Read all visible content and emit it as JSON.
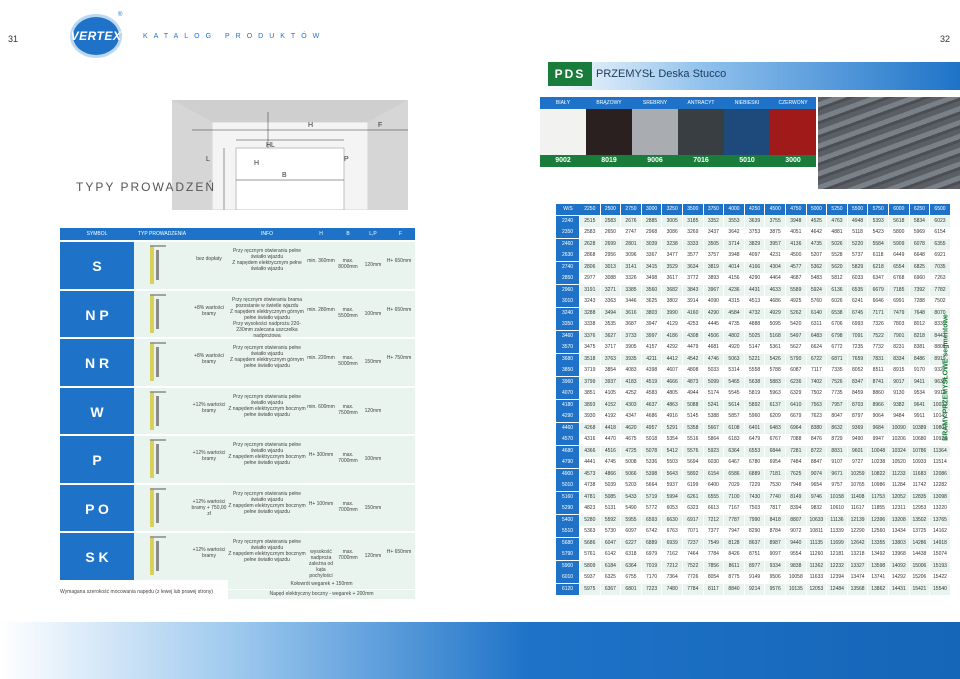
{
  "header": {
    "page_left": "31",
    "page_right": "32",
    "logo_text": "VERTEX",
    "catalog_label": "KATALOG PRODUKTÓW"
  },
  "product": {
    "badge": "PDS",
    "name": "PRZEMYSŁ Deska Stucco"
  },
  "colors": [
    {
      "name": "BIAŁY",
      "code": "9002",
      "hex": "#f2f2f0"
    },
    {
      "name": "BRĄZOWY",
      "code": "8019",
      "hex": "#2a2020"
    },
    {
      "name": "SREBRNY",
      "code": "9006",
      "hex": "#a9adb2"
    },
    {
      "name": "ANTRACYT",
      "code": "7016",
      "hex": "#383e42"
    },
    {
      "name": "NIEBIESKI",
      "code": "5010",
      "hex": "#1d4a7a"
    },
    {
      "name": "CZERWONY",
      "code": "3000",
      "hex": "#a11a1a"
    }
  ],
  "diagram": {
    "labels": {
      "H_top": "H",
      "F": "F",
      "HL": "HL",
      "L": "L",
      "H": "H",
      "P": "P",
      "B": "B"
    }
  },
  "types_title": "TYPY PROWADZEŃ",
  "left_table": {
    "headers": {
      "symbol": "SYMBOL",
      "type": "TYP PROWADZENIA",
      "info": "INFO",
      "h": "H",
      "b": "B",
      "lp": "L,P",
      "f": "F"
    },
    "rows": [
      {
        "symbol": "S",
        "value": "bez dopłaty",
        "info": "Przy ręcznym otwieraniu pełne światło wjazdu\nZ napędem elektrycznym pełne światło wjazdu",
        "h": "min. 360mm",
        "b": "max. 8000mm",
        "lp": "120mm",
        "f": "H+ 650mm"
      },
      {
        "symbol": "N P",
        "value": "+8% wartości bramy",
        "info": "Przy ręcznym otwieraniu brama pozostanie w świetle wjazdu\nZ napędem elektrycznym górnym pełne światło wjazdu\nPrzy wysokości nadprożu 220-230mm zalecana uszczelka nadprożowa",
        "h": "min. 280mm",
        "b": "max. 5500mm",
        "lp": "100mm",
        "f": "H+ 650mm"
      },
      {
        "symbol": "N R",
        "value": "+8% wartości bramy",
        "info": "Przy ręcznym otwieraniu pełne światło wjazdu\nZ napędem elektrycznym górnym pełne światło wjazdu",
        "h": "min. 220mm",
        "b": "max. 5000mm",
        "lp": "150mm",
        "f": "H+ 750mm"
      },
      {
        "symbol": "W",
        "value": "+12% wartości bramy",
        "info": "Przy ręcznym otwieraniu pełne światło wjazdu\nZ napędem elektrycznym bocznym pełne światło wjazdu",
        "h": "min. 600mm",
        "b": "max. 7500mm",
        "lp": "120mm",
        "f": ""
      },
      {
        "symbol": "P",
        "value": "+12% wartości bramy",
        "info": "Przy ręcznym otwieraniu pełne światło wjazdu\nZ napędem elektrycznym bocznym pełne światło wjazdu",
        "h": "H+ 300mm",
        "b": "max. 7000mm",
        "lp": "100mm",
        "f": ""
      },
      {
        "symbol": "P O",
        "value": "+12% wartości bramy + 750,00 zł",
        "info": "Przy ręcznym otwieraniu pełne światło wjazdu\nZ napędem elektrycznym bocznym pełne światło wjazdu",
        "h": "H+ 100mm",
        "b": "max. 7000mm",
        "lp": "150mm",
        "f": ""
      },
      {
        "symbol": "S K",
        "value": "+12% wartości bramy",
        "info": "Przy ręcznym otwieraniu pełne światło wjazdu\nZ napędem elektrycznym bocznym pełne światło wjazdu",
        "h": "wysokość nadproża zależna od kąta pochylości",
        "b": "max. 7000mm",
        "lp": "120mm",
        "f": "H+ 650mm"
      }
    ],
    "footer_1": "Kołowrót wegarek + 150mm",
    "footer_2": "Napęd elektryczny boczny - wegarek + 200mm",
    "note": "Wymagana szerokość mocowania napędu (z lewej lub prawej strony)"
  },
  "price_table": {
    "corner": "W/S",
    "widths": [
      "2250",
      "2500",
      "2750",
      "3000",
      "3250",
      "3500",
      "3750",
      "4000",
      "4250",
      "4500",
      "4750",
      "5000",
      "5250",
      "5500",
      "5750",
      "6000",
      "6250",
      "6500"
    ],
    "heights": [
      "2240",
      "2350",
      "2460",
      "2630",
      "2740",
      "2850",
      "2960",
      "3010",
      "3240",
      "3350",
      "3460",
      "3570",
      "3680",
      "3850",
      "3960",
      "4070",
      "4180",
      "4290",
      "4460",
      "4570",
      "4680",
      "4790",
      "4900",
      "5010",
      "5160",
      "5290",
      "5400",
      "5510",
      "5680",
      "5790",
      "5900",
      "6010",
      "6120"
    ],
    "values": [
      [
        "2515",
        "2583",
        "2676",
        "2885",
        "3005",
        "3185",
        "3352",
        "3553",
        "3639",
        "3755",
        "3948",
        "4525",
        "4763",
        "4948",
        "5393",
        "5618",
        "5834",
        "6023"
      ],
      [
        "2583",
        "2650",
        "2747",
        "2968",
        "3086",
        "3269",
        "3437",
        "3642",
        "3753",
        "3875",
        "4051",
        "4642",
        "4881",
        "5118",
        "5423",
        "5800",
        "5969",
        "6154"
      ],
      [
        "2628",
        "2699",
        "2801",
        "3039",
        "3238",
        "3333",
        "3505",
        "3714",
        "3829",
        "3957",
        "4136",
        "4735",
        "5026",
        "5220",
        "5584",
        "5909",
        "6078",
        "6355"
      ],
      [
        "2868",
        "2956",
        "3096",
        "3367",
        "3477",
        "3577",
        "3757",
        "3948",
        "4097",
        "4231",
        "4500",
        "5207",
        "5528",
        "5737",
        "6118",
        "6449",
        "6648",
        "6921"
      ],
      [
        "2806",
        "3013",
        "3141",
        "3415",
        "3529",
        "3634",
        "3819",
        "4014",
        "4166",
        "4304",
        "4577",
        "5362",
        "5620",
        "5829",
        "6218",
        "6554",
        "6825",
        "7035"
      ],
      [
        "2977",
        "3088",
        "3326",
        "3498",
        "3617",
        "3772",
        "3893",
        "4156",
        "4290",
        "4464",
        "4687",
        "5483",
        "5812",
        "6033",
        "6347",
        "6768",
        "6960",
        "7263"
      ],
      [
        "3191",
        "3271",
        "3385",
        "3560",
        "3682",
        "3843",
        "3967",
        "4236",
        "4431",
        "4633",
        "5589",
        "5924",
        "6136",
        "6535",
        "6679",
        "7185",
        "7392",
        "7782"
      ],
      [
        "3243",
        "3363",
        "3446",
        "3625",
        "3802",
        "3914",
        "4090",
        "4315",
        "4513",
        "4686",
        "4925",
        "5760",
        "6026",
        "6241",
        "6646",
        "6991",
        "7288",
        "7502"
      ],
      [
        "3288",
        "3494",
        "3616",
        "3803",
        "3990",
        "4160",
        "4290",
        "4584",
        "4732",
        "4929",
        "5262",
        "6140",
        "6538",
        "6745",
        "7171",
        "7479",
        "7648",
        "8070"
      ],
      [
        "3338",
        "3535",
        "3687",
        "3947",
        "4129",
        "4253",
        "4445",
        "4735",
        "4888",
        "5095",
        "5420",
        "6311",
        "6706",
        "6993",
        "7326",
        "7803",
        "8012",
        "8335"
      ],
      [
        "3376",
        "3627",
        "3733",
        "3997",
        "4186",
        "4308",
        "4506",
        "4802",
        "5025",
        "5168",
        "5497",
        "6483",
        "6798",
        "7091",
        "7522",
        "7901",
        "8218",
        "8441"
      ],
      [
        "3475",
        "3717",
        "3905",
        "4157",
        "4292",
        "4479",
        "4681",
        "4920",
        "5147",
        "5361",
        "5627",
        "6624",
        "6772",
        "7235",
        "7732",
        "8231",
        "8381",
        "8809"
      ],
      [
        "3518",
        "3763",
        "3935",
        "4211",
        "4412",
        "4542",
        "4746",
        "5063",
        "5221",
        "5426",
        "5790",
        "6722",
        "6871",
        "7659",
        "7831",
        "8334",
        "8486",
        "8919"
      ],
      [
        "3719",
        "3854",
        "4083",
        "4398",
        "4607",
        "4808",
        "5033",
        "5314",
        "5558",
        "5788",
        "6087",
        "7117",
        "7335",
        "8052",
        "8511",
        "8915",
        "9170",
        "9327"
      ],
      [
        "3799",
        "3937",
        "4183",
        "4519",
        "4666",
        "4873",
        "5099",
        "5465",
        "5638",
        "5883",
        "6236",
        "7402",
        "7526",
        "8347",
        "8741",
        "9017",
        "9411",
        "9638"
      ],
      [
        "3851",
        "4105",
        "4252",
        "4583",
        "4805",
        "4944",
        "5174",
        "5545",
        "5819",
        "5963",
        "6329",
        "7502",
        "7735",
        "8459",
        "8860",
        "9130",
        "9534",
        "9914"
      ],
      [
        "3893",
        "4152",
        "4303",
        "4637",
        "4863",
        "5088",
        "5241",
        "5614",
        "5892",
        "6137",
        "6410",
        "7563",
        "7957",
        "8703",
        "8966",
        "9382",
        "9641",
        "10032"
      ],
      [
        "3930",
        "4192",
        "4347",
        "4686",
        "4916",
        "5145",
        "5388",
        "5857",
        "5960",
        "6209",
        "6679",
        "7623",
        "8047",
        "8797",
        "9064",
        "9484",
        "9911",
        "10149"
      ],
      [
        "4268",
        "4418",
        "4620",
        "4957",
        "5291",
        "5358",
        "5667",
        "6108",
        "6401",
        "6483",
        "6964",
        "8380",
        "8632",
        "9369",
        "9684",
        "10090",
        "10389",
        "10801"
      ],
      [
        "4316",
        "4470",
        "4675",
        "5018",
        "5354",
        "5516",
        "5864",
        "6183",
        "6479",
        "6767",
        "7088",
        "8476",
        "8729",
        "9490",
        "9947",
        "10206",
        "10680",
        "10924"
      ],
      [
        "4366",
        "4516",
        "4725",
        "5078",
        "5412",
        "5576",
        "5923",
        "6364",
        "6553",
        "6844",
        "7281",
        "8722",
        "8831",
        "9601",
        "10048",
        "10324",
        "10786",
        "11364"
      ],
      [
        "4441",
        "4745",
        "5008",
        "5336",
        "5503",
        "5694",
        "6030",
        "6467",
        "6780",
        "6954",
        "7484",
        "8847",
        "9107",
        "9727",
        "10238",
        "10520",
        "10933",
        "11514"
      ],
      [
        "4573",
        "4866",
        "5066",
        "5398",
        "5643",
        "5892",
        "6154",
        "6586",
        "6889",
        "7181",
        "7625",
        "9074",
        "9671",
        "10259",
        "10822",
        "11233",
        "11683",
        "12086"
      ],
      [
        "4738",
        "5039",
        "5203",
        "5664",
        "5937",
        "6199",
        "6400",
        "7029",
        "7229",
        "7530",
        "7948",
        "9654",
        "9757",
        "10765",
        "10986",
        "11284",
        "11742",
        "12282"
      ],
      [
        "4781",
        "5085",
        "5433",
        "5719",
        "5994",
        "6261",
        "6555",
        "7100",
        "7430",
        "7740",
        "8149",
        "9746",
        "10158",
        "11408",
        "11753",
        "12052",
        "12835",
        "13098"
      ],
      [
        "4823",
        "5131",
        "5490",
        "5772",
        "6053",
        "6323",
        "6613",
        "7167",
        "7503",
        "7817",
        "8394",
        "9832",
        "10610",
        "11617",
        "11855",
        "12311",
        "12953",
        "13220"
      ],
      [
        "5280",
        "5592",
        "5955",
        "6593",
        "6630",
        "6917",
        "7212",
        "7787",
        "7990",
        "8418",
        "8807",
        "10633",
        "11136",
        "12139",
        "12396",
        "13208",
        "13502",
        "13765"
      ],
      [
        "5363",
        "5730",
        "6097",
        "6742",
        "6763",
        "7071",
        "7377",
        "7947",
        "8290",
        "8784",
        "9072",
        "10811",
        "11339",
        "12290",
        "12560",
        "13434",
        "13725",
        "14162"
      ],
      [
        "5686",
        "6047",
        "6227",
        "6889",
        "6939",
        "7237",
        "7549",
        "8128",
        "8637",
        "8987",
        "9440",
        "11135",
        "11699",
        "12642",
        "13355",
        "13803",
        "14286",
        "14918"
      ],
      [
        "5761",
        "6142",
        "6318",
        "6979",
        "7162",
        "7464",
        "7784",
        "8426",
        "8751",
        "9097",
        "9554",
        "11260",
        "12181",
        "13218",
        "13492",
        "13968",
        "14438",
        "15074"
      ],
      [
        "5809",
        "6184",
        "6364",
        "7019",
        "7212",
        "7522",
        "7856",
        "8611",
        "8977",
        "9334",
        "9838",
        "11362",
        "12232",
        "13327",
        "13598",
        "14092",
        "15006",
        "15193"
      ],
      [
        "5937",
        "6325",
        "6755",
        "7170",
        "7364",
        "7726",
        "8054",
        "8775",
        "9149",
        "9506",
        "10058",
        "11633",
        "12394",
        "13474",
        "13741",
        "14292",
        "15206",
        "15422"
      ],
      [
        "5975",
        "6367",
        "6801",
        "7223",
        "7480",
        "7784",
        "8117",
        "8840",
        "9214",
        "9576",
        "10135",
        "12053",
        "12484",
        "13568",
        "13862",
        "14431",
        "15421",
        "15540"
      ]
    ]
  },
  "side_label": "BRAMY PRZEMYSŁOWE segmentowe"
}
